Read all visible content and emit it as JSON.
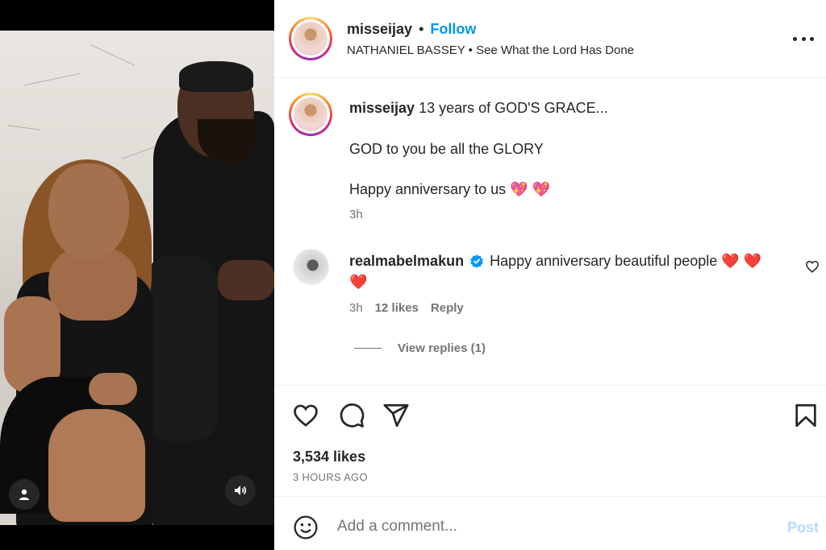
{
  "post": {
    "username": "misseijay",
    "follow_label": "Follow",
    "separator": "•",
    "audio_artist": "NATHANIEL BASSEY",
    "audio_title": "See What the Lord Has Done"
  },
  "caption": {
    "username": "misseijay",
    "line1": "13 years of GOD'S GRACE...",
    "line2": "GOD to you be all the GLORY",
    "line3": "Happy anniversary to us 💖 💖",
    "time": "3h"
  },
  "comment": {
    "username": "realmabelmakun",
    "text_part1": "Happy anniversary beautiful people ❤️ ❤️",
    "text_part2": "❤️",
    "time": "3h",
    "likes": "12 likes",
    "reply_label": "Reply",
    "view_replies": "View replies (1)"
  },
  "actions": {
    "likes": "3,534 likes",
    "posted_ago": "3 HOURS AGO"
  },
  "composer": {
    "placeholder": "Add a comment...",
    "post_label": "Post"
  },
  "colors": {
    "follow": "#0095f6",
    "verified": "#0095f6",
    "post_disabled": "#b3dbff"
  }
}
